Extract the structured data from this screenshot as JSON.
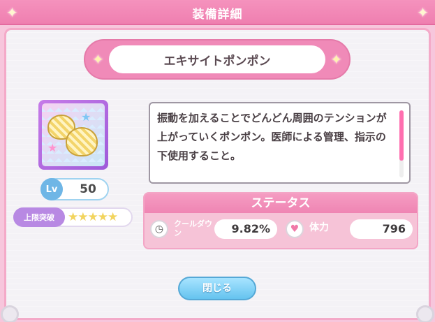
{
  "header": {
    "title": "装備詳細"
  },
  "item": {
    "name": "エキサイトポンポン",
    "level_label": "Lv",
    "level": "50",
    "limit_break_label": "上限突破",
    "limit_break_stars": "★★★★★",
    "limit_break_value": 5,
    "description": "振動を加えることでどんどん周囲のテンションが上がっていくポンポン。医師による管理、指示の下使用すること。"
  },
  "status": {
    "title": "ステータス",
    "stats": [
      {
        "label": "クールダウン",
        "value": "9.82%",
        "icon": "clock-icon"
      },
      {
        "label": "体力",
        "value": "796",
        "icon": "heart-icon"
      }
    ]
  },
  "buttons": {
    "close": "閉じる"
  },
  "colors": {
    "accent_pink": "#ef85b3",
    "accent_blue": "#65c3ef",
    "purple": "#b889e3"
  }
}
